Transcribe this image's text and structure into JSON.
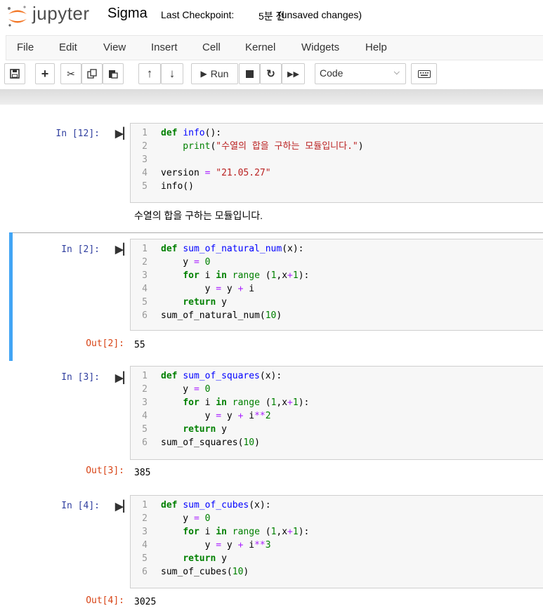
{
  "header": {
    "logo_text": "jupyter",
    "notebook_name": "Sigma",
    "checkpoint_label": "Last Checkpoint: ",
    "checkpoint_time": "5분 전",
    "unsaved": "(unsaved changes)"
  },
  "menu": [
    "File",
    "Edit",
    "View",
    "Insert",
    "Cell",
    "Kernel",
    "Widgets",
    "Help"
  ],
  "toolbar": {
    "run_label": "Run",
    "cell_type": "Code",
    "icons": [
      "save-icon",
      "plus-icon",
      "scissors-icon",
      "copy-icon",
      "paste-icon",
      "arrow-up-icon",
      "arrow-down-icon",
      "play-icon",
      "stop-icon",
      "restart-icon",
      "fast-forward-icon",
      "keyboard-icon"
    ]
  },
  "cells": [
    {
      "prompt": "In [12]:",
      "lines": [
        [
          {
            "t": "def",
            "c": "kw"
          },
          {
            "t": " "
          },
          {
            "t": "info",
            "c": "fn"
          },
          {
            "t": "():"
          }
        ],
        [
          {
            "t": "    print",
            "c": "bi"
          },
          {
            "t": "("
          },
          {
            "t": "\"수열의 합을 구하는 모듈입니다.\"",
            "c": "str"
          },
          {
            "t": ")"
          }
        ],
        [],
        [
          {
            "t": "version "
          },
          {
            "t": "=",
            "c": "op"
          },
          {
            "t": " "
          },
          {
            "t": "\"21.05.27\"",
            "c": "str"
          }
        ],
        [
          {
            "t": "info()"
          }
        ]
      ],
      "output_prompt": "",
      "output": "수열의 합을 구하는 모듈입니다."
    },
    {
      "prompt": "In [2]:",
      "lines": [
        [
          {
            "t": "def",
            "c": "kw"
          },
          {
            "t": " "
          },
          {
            "t": "sum_of_natural_num",
            "c": "fn"
          },
          {
            "t": "(x):"
          }
        ],
        [
          {
            "t": "    y "
          },
          {
            "t": "=",
            "c": "op"
          },
          {
            "t": " "
          },
          {
            "t": "0",
            "c": "num"
          }
        ],
        [
          {
            "t": "    "
          },
          {
            "t": "for",
            "c": "kw"
          },
          {
            "t": " i "
          },
          {
            "t": "in",
            "c": "kw"
          },
          {
            "t": " "
          },
          {
            "t": "range",
            "c": "bi"
          },
          {
            "t": " ("
          },
          {
            "t": "1",
            "c": "num"
          },
          {
            "t": ",x"
          },
          {
            "t": "+",
            "c": "op"
          },
          {
            "t": "1",
            "c": "num"
          },
          {
            "t": "):"
          }
        ],
        [
          {
            "t": "        y "
          },
          {
            "t": "=",
            "c": "op"
          },
          {
            "t": " y "
          },
          {
            "t": "+",
            "c": "op"
          },
          {
            "t": " i"
          }
        ],
        [
          {
            "t": "    "
          },
          {
            "t": "return",
            "c": "kw"
          },
          {
            "t": " y"
          }
        ],
        [
          {
            "t": "sum_of_natural_num("
          },
          {
            "t": "10",
            "c": "num"
          },
          {
            "t": ")"
          }
        ]
      ],
      "output_prompt": "Out[2]:",
      "output": "55"
    },
    {
      "prompt": "In [3]:",
      "lines": [
        [
          {
            "t": "def",
            "c": "kw"
          },
          {
            "t": " "
          },
          {
            "t": "sum_of_squares",
            "c": "fn"
          },
          {
            "t": "(x):"
          }
        ],
        [
          {
            "t": "    y "
          },
          {
            "t": "=",
            "c": "op"
          },
          {
            "t": " "
          },
          {
            "t": "0",
            "c": "num"
          }
        ],
        [
          {
            "t": "    "
          },
          {
            "t": "for",
            "c": "kw"
          },
          {
            "t": " i "
          },
          {
            "t": "in",
            "c": "kw"
          },
          {
            "t": " "
          },
          {
            "t": "range",
            "c": "bi"
          },
          {
            "t": " ("
          },
          {
            "t": "1",
            "c": "num"
          },
          {
            "t": ",x"
          },
          {
            "t": "+",
            "c": "op"
          },
          {
            "t": "1",
            "c": "num"
          },
          {
            "t": "):"
          }
        ],
        [
          {
            "t": "        y "
          },
          {
            "t": "=",
            "c": "op"
          },
          {
            "t": " y "
          },
          {
            "t": "+",
            "c": "op"
          },
          {
            "t": " i"
          },
          {
            "t": "**",
            "c": "op"
          },
          {
            "t": "2",
            "c": "num"
          }
        ],
        [
          {
            "t": "    "
          },
          {
            "t": "return",
            "c": "kw"
          },
          {
            "t": " y"
          }
        ],
        [
          {
            "t": "sum_of_squares("
          },
          {
            "t": "10",
            "c": "num"
          },
          {
            "t": ")"
          }
        ]
      ],
      "output_prompt": "Out[3]:",
      "output": "385"
    },
    {
      "prompt": "In [4]:",
      "lines": [
        [
          {
            "t": "def",
            "c": "kw"
          },
          {
            "t": " "
          },
          {
            "t": "sum_of_cubes",
            "c": "fn"
          },
          {
            "t": "(x):"
          }
        ],
        [
          {
            "t": "    y "
          },
          {
            "t": "=",
            "c": "op"
          },
          {
            "t": " "
          },
          {
            "t": "0",
            "c": "num"
          }
        ],
        [
          {
            "t": "    "
          },
          {
            "t": "for",
            "c": "kw"
          },
          {
            "t": " i "
          },
          {
            "t": "in",
            "c": "kw"
          },
          {
            "t": " "
          },
          {
            "t": "range",
            "c": "bi"
          },
          {
            "t": " ("
          },
          {
            "t": "1",
            "c": "num"
          },
          {
            "t": ",x"
          },
          {
            "t": "+",
            "c": "op"
          },
          {
            "t": "1",
            "c": "num"
          },
          {
            "t": "):"
          }
        ],
        [
          {
            "t": "        y "
          },
          {
            "t": "=",
            "c": "op"
          },
          {
            "t": " y "
          },
          {
            "t": "+",
            "c": "op"
          },
          {
            "t": " i"
          },
          {
            "t": "**",
            "c": "op"
          },
          {
            "t": "3",
            "c": "num"
          }
        ],
        [
          {
            "t": "    "
          },
          {
            "t": "return",
            "c": "kw"
          },
          {
            "t": " y"
          }
        ],
        [
          {
            "t": "sum_of_cubes("
          },
          {
            "t": "10",
            "c": "num"
          },
          {
            "t": ")"
          }
        ]
      ],
      "output_prompt": "Out[4]:",
      "output": "3025"
    }
  ],
  "colors": {
    "selected_cell_bar": "#42a5f5",
    "in_prompt": "#303f9f",
    "out_prompt": "#d84315",
    "logo_orange": "#f37726"
  }
}
